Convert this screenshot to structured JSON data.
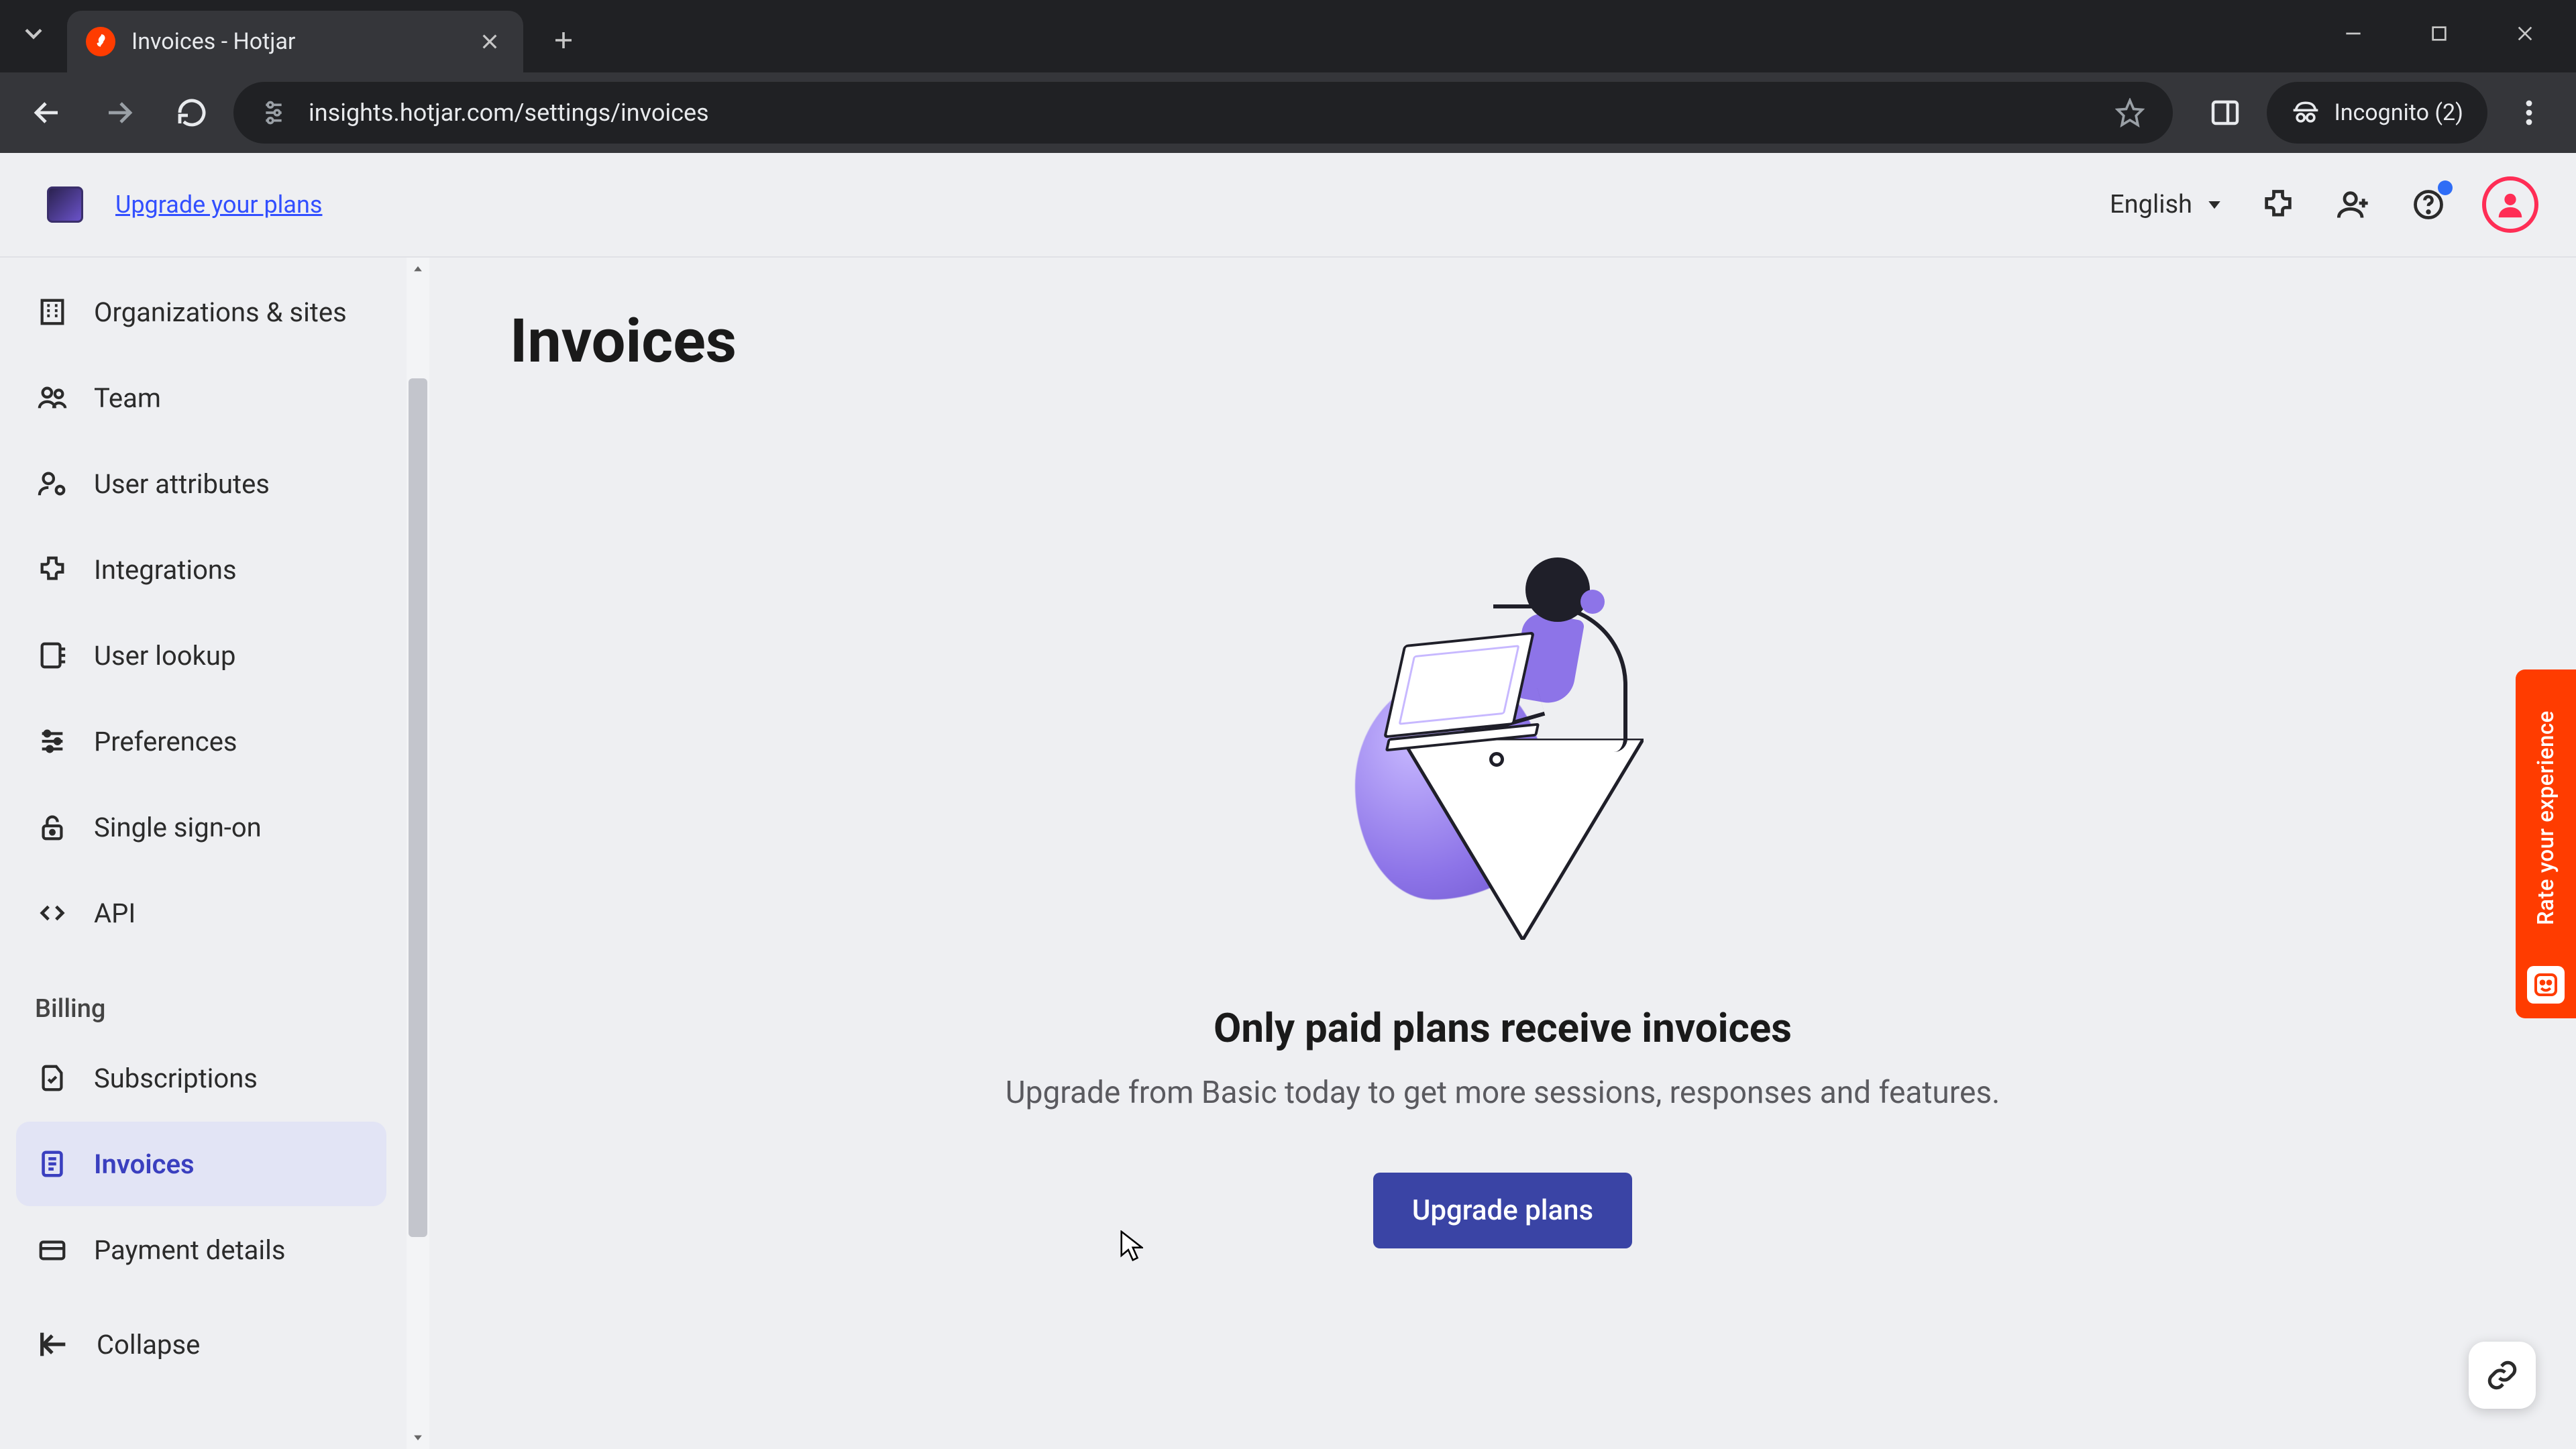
{
  "browser": {
    "tab_title": "Invoices - Hotjar",
    "url": "insights.hotjar.com/settings/invoices",
    "incognito_label": "Incognito (2)"
  },
  "header": {
    "upgrade_link": "Upgrade your plans",
    "language": "English"
  },
  "sidebar": {
    "items_top": [
      {
        "label": "Organizations & sites"
      },
      {
        "label": "Team"
      },
      {
        "label": "User attributes"
      },
      {
        "label": "Integrations"
      },
      {
        "label": "User lookup"
      },
      {
        "label": "Preferences"
      },
      {
        "label": "Single sign-on"
      },
      {
        "label": "API"
      }
    ],
    "section_billing": "Billing",
    "items_billing": [
      {
        "label": "Subscriptions"
      },
      {
        "label": "Invoices"
      },
      {
        "label": "Payment details"
      }
    ],
    "collapse": "Collapse"
  },
  "main": {
    "title": "Invoices",
    "empty_heading": "Only paid plans receive invoices",
    "empty_sub": "Upgrade from Basic today to get more sessions, responses and features.",
    "upgrade_button": "Upgrade plans"
  },
  "feedback": {
    "label": "Rate your experience"
  }
}
